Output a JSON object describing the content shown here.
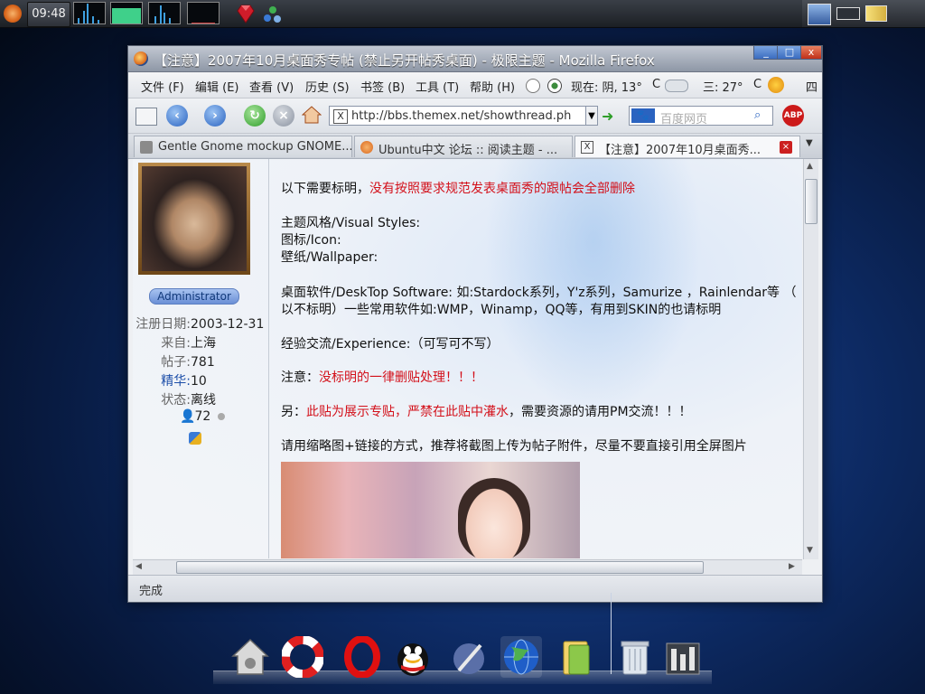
{
  "top_panel": {
    "clock": "09:48",
    "icons": [
      "ubuntu-logo-icon",
      "system-monitor-icon",
      "ruby-icon",
      "water-drops-icon",
      "window-list-icon",
      "desktop-icon",
      "notes-icon"
    ]
  },
  "window": {
    "title": "【注意】2007年10月桌面秀专帖 (禁止另开帖秀桌面) - 极限主题 - Mozilla Firefox",
    "controls": {
      "minimize": "_",
      "maximize": "□",
      "close": "x"
    }
  },
  "menubar": {
    "items": [
      "文件 (F)",
      "编辑 (E)",
      "查看 (V)",
      "历史 (S)",
      "书签 (B)",
      "工具 (T)",
      "帮助 (H)"
    ],
    "weather_now": "现在: 阴, 13°",
    "weather_unit1": "C",
    "weather_next": "三: 27°",
    "weather_unit2": "C",
    "weather_more": "四"
  },
  "navbar": {
    "url": "http://bbs.themex.net/showthread.ph",
    "search_placeholder": "百度网页",
    "abp": "ABP"
  },
  "tabs": [
    {
      "label": "Gentle Gnome mockup GNOME...",
      "active": false
    },
    {
      "label": "Ubuntu中文 论坛 :: 阅读主题 - ...",
      "active": false
    },
    {
      "label": "【注意】2007年10月桌面秀...",
      "active": true
    }
  ],
  "user": {
    "role": "Administrator",
    "reg_label": "注册日期:",
    "reg_value": "2003-12-31",
    "from_label": "来自:",
    "from_value": "上海",
    "posts_label": "帖子:",
    "posts_value": "781",
    "elite_label": "精华:",
    "elite_value": "10",
    "status_label": "状态:",
    "status_value": "离线",
    "reputation": "72"
  },
  "post": {
    "line1_normal": "以下需要标明，",
    "line1_red": "没有按照要求规范发表桌面秀的跟帖会全部删除",
    "line2": "主题风格/Visual Styles:",
    "line3": "图标/Icon:",
    "line4": "壁纸/Wallpaper:",
    "line5": "桌面软件/DeskTop Software: 如:Stardock系列，Y'z系列，Samurize ，Rainlendar等 （",
    "line6": "以不标明）一些常用软件如:WMP，Winamp，QQ等，有用到SKIN的也请标明",
    "line7": "经验交流/Experience:（可写可不写）",
    "line8_normal": "注意：",
    "line8_red": "没标明的一律删贴处理！！！",
    "line9_normal1": "另：",
    "line9_red": "此贴为展示专贴，严禁在此贴中灌水",
    "line9_normal2": "，需要资源的请用PM交流！！！",
    "line10": "请用缩略图+链接的方式，推荐将截图上传为帖子附件，尽量不要直接引用全屏图片"
  },
  "statusbar": {
    "text": "完成"
  },
  "dock": {
    "icons": [
      "home-icon",
      "lifebuoy-icon",
      "opera-icon",
      "qq-penguin-icon",
      "pen-tool-icon",
      "globe-icon",
      "folder-icon",
      "trash-icon",
      "panel-icon"
    ]
  },
  "colors": {
    "accent_red": "#d3101a",
    "link_blue": "#1c4ea8"
  }
}
